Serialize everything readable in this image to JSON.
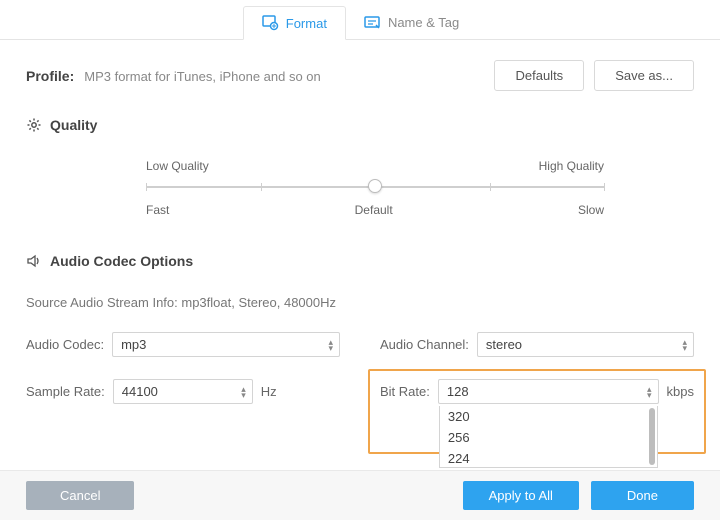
{
  "tabs": {
    "format": "Format",
    "name_tag": "Name & Tag"
  },
  "profile": {
    "label": "Profile:",
    "description": "MP3 format for iTunes, iPhone and so on"
  },
  "buttons": {
    "defaults": "Defaults",
    "save_as": "Save as...",
    "cancel": "Cancel",
    "apply_all": "Apply to All",
    "done": "Done"
  },
  "quality": {
    "heading": "Quality",
    "low": "Low Quality",
    "high": "High Quality",
    "fast": "Fast",
    "default": "Default",
    "slow": "Slow"
  },
  "audio": {
    "heading": "Audio Codec Options",
    "source_info": "Source Audio Stream Info: mp3float, Stereo, 48000Hz",
    "codec_label": "Audio Codec:",
    "codec_value": "mp3",
    "channel_label": "Audio Channel:",
    "channel_value": "stereo",
    "sample_label": "Sample Rate:",
    "sample_value": "44100",
    "sample_unit": "Hz",
    "bitrate_label": "Bit Rate:",
    "bitrate_value": "128",
    "bitrate_unit": "kbps",
    "bitrate_options": [
      "320",
      "256",
      "224"
    ]
  }
}
